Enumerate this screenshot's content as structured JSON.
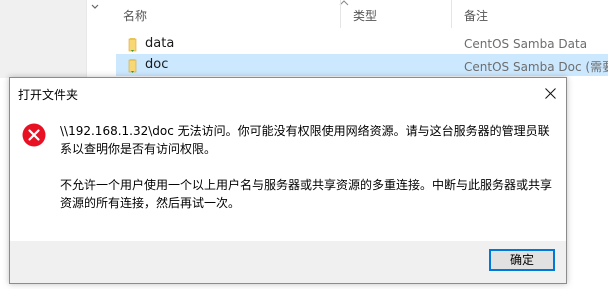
{
  "explorer": {
    "columns": {
      "name": "名称",
      "type": "类型",
      "note": "备注"
    },
    "files": [
      {
        "name": "data",
        "note": "CentOS Samba Data"
      },
      {
        "name": "doc",
        "note": "CentOS Samba Doc (需要"
      }
    ]
  },
  "dialog": {
    "title": "打开文件夹",
    "message_1": "\\\\192.168.1.32\\doc 无法访问。你可能没有权限使用网络资源。请与这台服务器的管理员联系以查明你是否有访问权限。",
    "message_2": "不允许一个用户使用一个以上用户名与服务器或共享资源的多重连接。中断与此服务器或共享资源的所有连接，然后再试一次。",
    "ok_label": "确定"
  },
  "colors": {
    "error": "#e81123",
    "accent": "#0078d7",
    "selection": "#cce8ff",
    "folder": "#f8d775"
  },
  "icons": {
    "error": "error-icon",
    "close": "close-icon",
    "folder": "folder-icon"
  }
}
